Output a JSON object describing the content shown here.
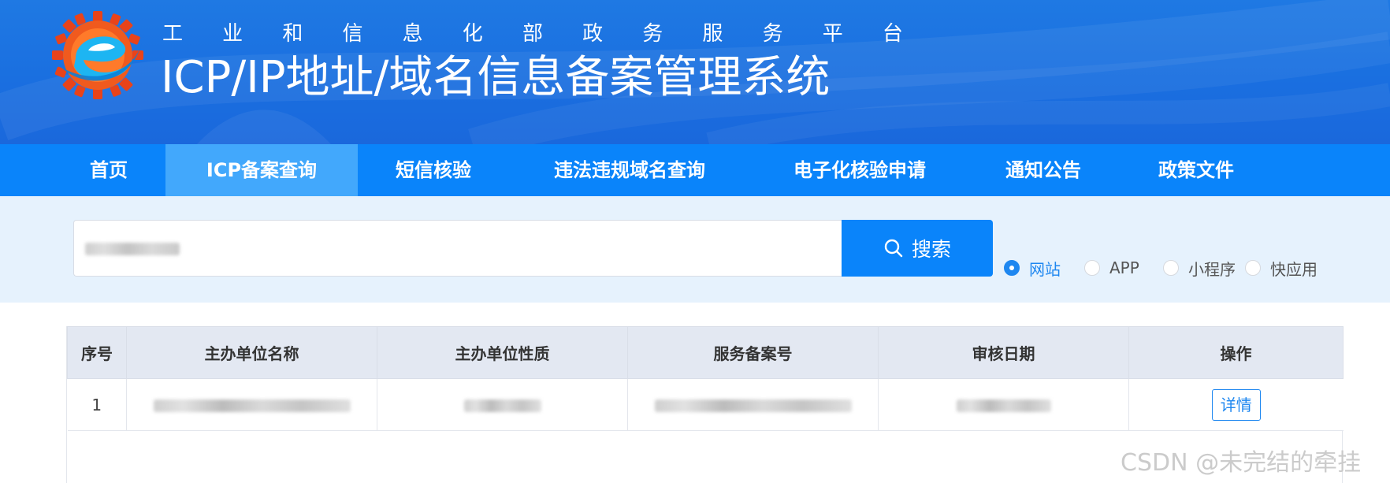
{
  "header": {
    "ministry_chars": [
      "工",
      "业",
      "和",
      "信",
      "息",
      "化",
      "部",
      "政",
      "务",
      "服",
      "务",
      "平",
      "台"
    ],
    "system_title": "ICP/IP地址/域名信息备案管理系统"
  },
  "nav": {
    "items": [
      {
        "label": "首页"
      },
      {
        "label": "ICP备案查询",
        "active": true
      },
      {
        "label": "短信核验"
      },
      {
        "label": "违法违规域名查询"
      },
      {
        "label": "电子化核验申请"
      },
      {
        "label": "通知公告"
      },
      {
        "label": "政策文件"
      }
    ]
  },
  "search": {
    "value": "",
    "button_label": "搜索",
    "icon": "search-icon",
    "types": [
      {
        "label": "网站",
        "checked": true
      },
      {
        "label": "APP",
        "checked": false
      },
      {
        "label": "小程序",
        "checked": false
      },
      {
        "label": "快应用",
        "checked": false
      }
    ]
  },
  "table": {
    "columns": [
      "序号",
      "主办单位名称",
      "主办单位性质",
      "服务备案号",
      "审核日期",
      "操作"
    ],
    "rows": [
      {
        "index": "1",
        "action_label": "详情"
      }
    ]
  },
  "watermark": "CSDN @未完结的牵挂",
  "colors": {
    "header_blue": "#1a6fe0",
    "nav_blue": "#0a84fa",
    "nav_active": "#42a8fc",
    "search_band": "#e6f2fd",
    "accent": "#1e87f0"
  }
}
